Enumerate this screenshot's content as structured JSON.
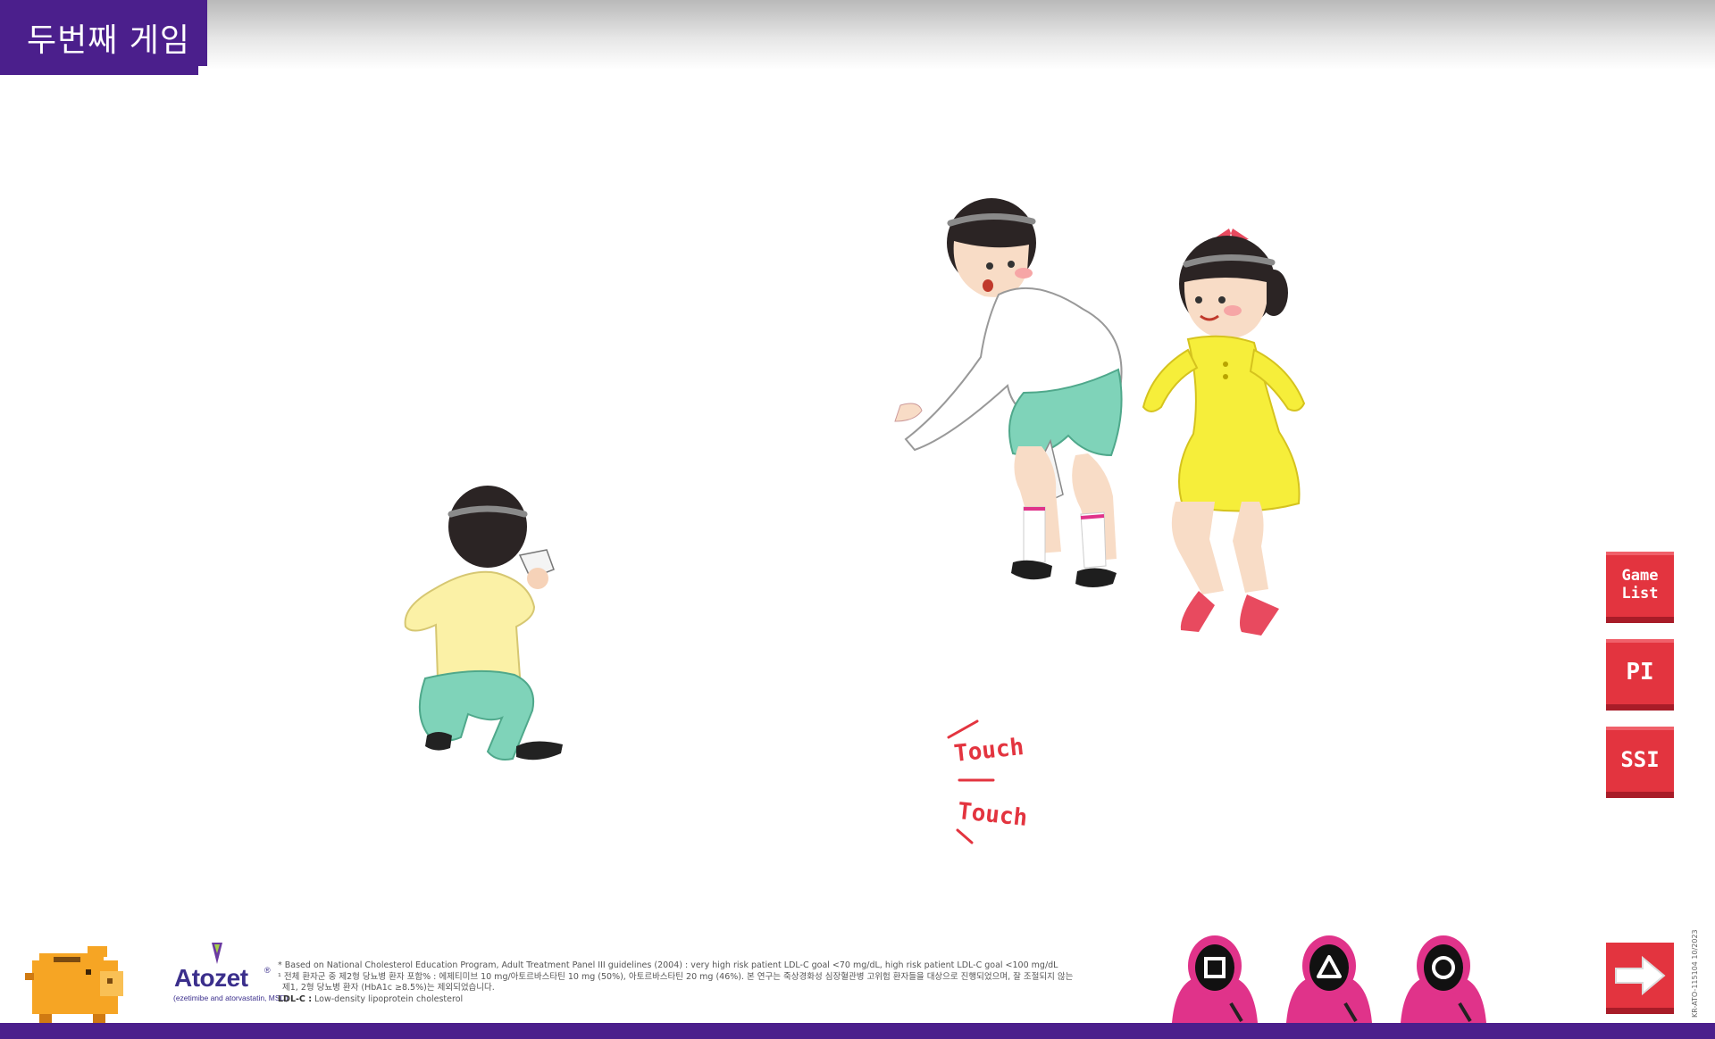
{
  "header": {
    "title": "두번째 게임"
  },
  "side_menu": {
    "game_list": "Game\nList",
    "pi": "PI",
    "ssi": "SSI"
  },
  "touch_labels": [
    "Touch",
    "Touch"
  ],
  "brand": {
    "name": "Atozet",
    "reg": "®",
    "subtitle": "(ezetimibe and atorvastatin, MSD)"
  },
  "footnotes": {
    "line1": "* Based on National Cholesterol Education Program, Adult Treatment Panel III guidelines (2004) : very high risk patient LDL-C goal <70 mg/dL, high risk patient LDL-C goal <100 mg/dL",
    "line2": "¹ 전체 환자군 중 제2형 당뇨병 환자 포함% : 에제티미브 10 mg/아토르바스타틴 10 mg (50%), 아토르바스타틴 20 mg (46%). 본 연구는 죽상경화성 심장혈관병 고위험 환자들을 대상으로 진행되었으며, 잘 조절되지 않는",
    "line3": "제1, 2형 당뇨병 환자 (HbA1c ≥8.5%)는 제외되었습니다.",
    "ldl_label": "LDL-C :",
    "ldl_text": "Low-density lipoprotein cholesterol"
  },
  "doc_code": "KR-ATO-115104 10/2023",
  "colors": {
    "brand_purple": "#4b1f8c",
    "button_red": "#e3343f",
    "guard_pink": "#e0338a"
  },
  "icons": {
    "guards": [
      "square-symbol",
      "triangle-symbol",
      "circle-symbol"
    ],
    "next": "right-arrow-icon",
    "piggy_bank": "pixel-piggy-bank-icon"
  }
}
